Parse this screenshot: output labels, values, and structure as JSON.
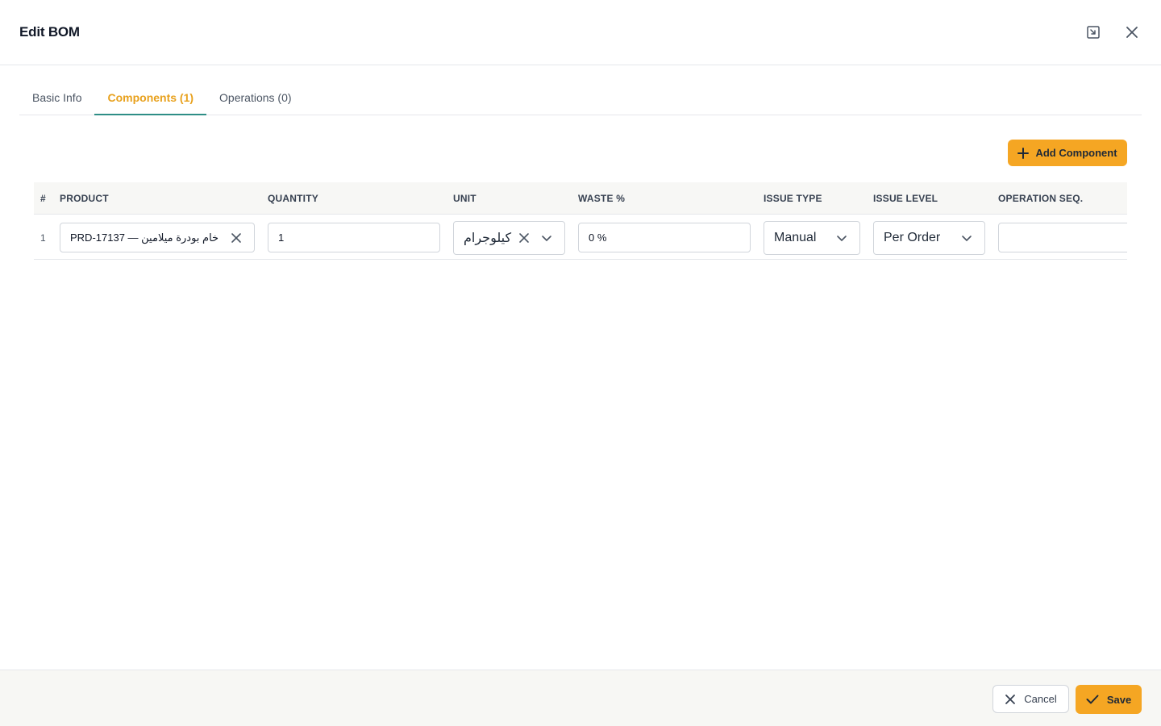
{
  "dialog": {
    "title": "Edit BOM"
  },
  "header_icons": {
    "restore": "window-restore-icon",
    "close": "close-icon"
  },
  "tabs": [
    {
      "label": "Basic Info",
      "active": false
    },
    {
      "label": "Components (1)",
      "active": true
    },
    {
      "label": "Operations (0)",
      "active": false
    }
  ],
  "toolbar": {
    "add_label": "Add Component"
  },
  "table": {
    "columns": [
      "#",
      "PRODUCT",
      "QUANTITY",
      "UNIT",
      "WASTE %",
      "ISSUE TYPE",
      "ISSUE LEVEL",
      "OPERATION SEQ."
    ],
    "rows": [
      {
        "num": "1",
        "product": "PRD-17137 — خام بودرة ميلامين",
        "quantity": "1",
        "unit": "كيلوجرام",
        "waste": "0 %",
        "issue_type": "Manual",
        "issue_level": "Per Order",
        "operation_seq": ""
      }
    ]
  },
  "footer": {
    "cancel_label": "Cancel",
    "save_label": "Save"
  },
  "colors": {
    "accent": "#f5a623",
    "tab_active_text": "#e8a11d",
    "tab_underline": "#2e8e86"
  }
}
